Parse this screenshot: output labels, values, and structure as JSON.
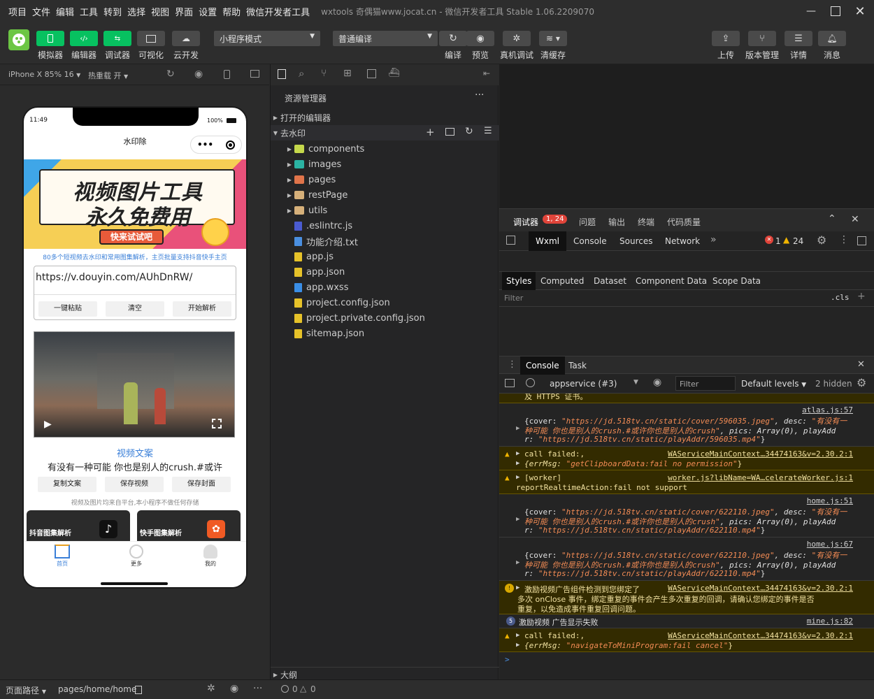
{
  "menu": {
    "items": [
      "项目",
      "文件",
      "编辑",
      "工具",
      "转到",
      "选择",
      "视图",
      "界面",
      "设置",
      "帮助",
      "微信开发者工具"
    ],
    "window_title": "wxtools 奇偶猫www.jocat.cn - 微信开发者工具 Stable 1.06.2209070"
  },
  "toolbar": {
    "simulator": "模拟器",
    "editor": "编辑器",
    "debugger": "调试器",
    "visual": "可视化",
    "cloud": "云开发",
    "mode": "小程序模式",
    "compile_mode": "普通编译",
    "compile": "编译",
    "preview": "预览",
    "real_debug": "真机调试",
    "clear_cache": "清缓存",
    "upload": "上传",
    "version": "版本管理",
    "details": "详情",
    "messages": "消息"
  },
  "simbar": {
    "device": "iPhone X 85% 16",
    "hotreload": "热重载 开"
  },
  "phone": {
    "time": "11:49",
    "battery": "100%",
    "title": "水印除",
    "banner_line1": "视频图片工具",
    "banner_line2": "永久免费用",
    "banner_button": "快来试试吧",
    "subtitle": "80多个短视频去水印和常用图集解析，主页批量支持抖音快手主页",
    "url_value": "https://v.douyin.com/AUhDnRW/",
    "btn_paste": "一键粘贴",
    "btn_clear": "清空",
    "btn_parse": "开始解析",
    "video_caption_title": "视频文案",
    "video_caption": "有没有一种可能 你也是别人的crush.#或许",
    "btn_copy": "复制文案",
    "btn_save_video": "保存视频",
    "btn_save_cover": "保存封面",
    "disclaimer": "视频及图片均来自平台,本小程序不做任何存储",
    "card1": "抖音图集解析",
    "card2": "快手图集解析",
    "nav_home": "首页",
    "nav_more": "更多",
    "nav_mine": "我的"
  },
  "explorer": {
    "header": "资源管理器",
    "open_editors": "打开的编辑器",
    "project": "去水印",
    "items": [
      {
        "name": "components",
        "type": "folder",
        "color": "#c5d84b"
      },
      {
        "name": "images",
        "type": "folder",
        "color": "#2bb3a3"
      },
      {
        "name": "pages",
        "type": "folder",
        "color": "#e0744a"
      },
      {
        "name": "restPage",
        "type": "folder",
        "color": "#d6b07a"
      },
      {
        "name": "utils",
        "type": "folder",
        "color": "#d6b07a"
      },
      {
        "name": ".eslintrc.js",
        "type": "file",
        "color": "#4a5bd0"
      },
      {
        "name": "功能介绍.txt",
        "type": "file",
        "color": "#4a8fe0"
      },
      {
        "name": "app.js",
        "type": "file",
        "color": "#e6c229"
      },
      {
        "name": "app.json",
        "type": "file",
        "color": "#e6c229"
      },
      {
        "name": "app.wxss",
        "type": "file",
        "color": "#3a8ee6"
      },
      {
        "name": "project.config.json",
        "type": "file",
        "color": "#e6c229"
      },
      {
        "name": "project.private.config.json",
        "type": "file",
        "color": "#e6c229"
      },
      {
        "name": "sitemap.json",
        "type": "file",
        "color": "#e6c229"
      }
    ],
    "outline": "大纲"
  },
  "devtools": {
    "tabs": [
      "调试器",
      "问题",
      "输出",
      "终端",
      "代码质量"
    ],
    "badge": "1, 24",
    "subtabs": [
      "Wxml",
      "Console",
      "Sources",
      "Network"
    ],
    "err_count": "1",
    "warn_count": "24",
    "style_tabs": [
      "Styles",
      "Computed",
      "Dataset",
      "Component Data",
      "Scope Data"
    ],
    "filter": "Filter",
    "cls": ".cls",
    "drawer_tabs": [
      "Console",
      "Task"
    ],
    "context": "appservice (#3)",
    "filter_placeholder": "Filter",
    "levels": "Default levels",
    "hidden": "2 hidden"
  },
  "console": {
    "l0": "及 HTTPS 证书。",
    "l1_src": "atlas.js:57",
    "l1_a": "{cover: ",
    "l1_b": "\"https://jd.518tv.cn/static/cover/596035.jpeg\"",
    "l1_c": ", desc: ",
    "l1_d": "\"有没有一",
    "l1_e": "种可能 你也是别人的crush.#或许你也是别人的crush\"",
    "l1_f": ", pics: Array(0), playAdd",
    "l1_g": "r: ",
    "l1_h": "\"https://jd.518tv.cn/static/playAddr/596035.mp4\"",
    "l1_i": "}",
    "w1_text": "call failed:,",
    "w1_src": "WAServiceMainContext…34474163&v=2.30.2:1",
    "w1_b": "{errMsg: ",
    "w1_c": "\"getClipboardData:fail no permission\"",
    "w1_d": "}",
    "w2_text": "[worker]",
    "w2_src": "worker.js?libName=WA…celerateWorker.js:1",
    "w2_b": "reportRealtimeAction:fail not support",
    "l2_src": "home.js:51",
    "l2_b": "\"https://jd.518tv.cn/static/cover/622110.jpeg\"",
    "l2_h": "\"https://jd.518tv.cn/static/playAddr/622110.mp4\"",
    "l3_src": "home.js:67",
    "w3_text": "激励视频广告组件检测到您绑定了",
    "w3_src": "WAServiceMainContext…34474163&v=2.30.2:1",
    "w3_b": "多次 onClose 事件，绑定重复的事件会产生多次重复的回调，请确认您绑定的事件是否",
    "w3_c": "重复，以免造成事件重复回调问题。",
    "i1_badge": "5",
    "i1_text": "激励视频 广告显示失败",
    "i1_src": "mine.js:82",
    "w4_text": "call failed:,",
    "w4_src": "WAServiceMainContext…34474163&v=2.30.2:1",
    "w4_b": "{errMsg: ",
    "w4_c": "\"navigateToMiniProgram:fail cancel\"",
    "w4_d": "}",
    "prompt": ">"
  },
  "status": {
    "page_path_label": "页面路径",
    "page_path": "pages/home/home",
    "errors": "0",
    "warnings": "0"
  },
  "colors": {
    "accent_green": "#07c160",
    "badge_red": "#e0443a",
    "warn_bg": "#332b00"
  }
}
